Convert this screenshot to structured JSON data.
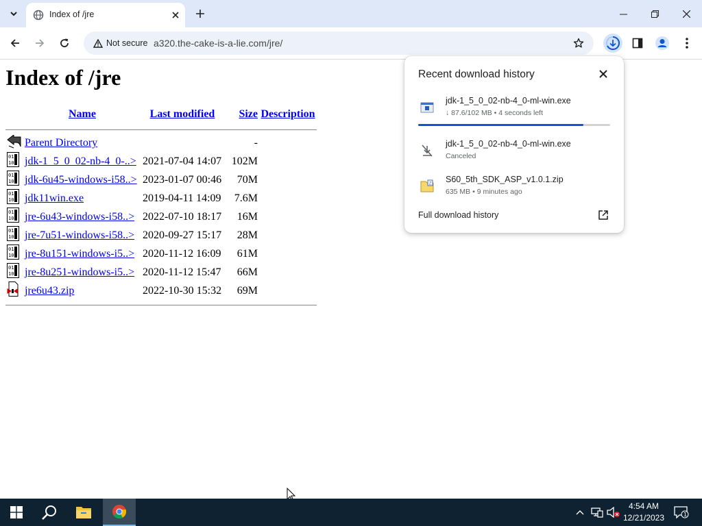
{
  "browser": {
    "tab_title": "Index of /jre",
    "security_label": "Not secure",
    "url": "a320.the-cake-is-a-lie.com/jre/"
  },
  "page": {
    "heading": "Index of /jre",
    "columns": [
      "Name",
      "Last modified",
      "Size",
      "Description"
    ],
    "parent": {
      "name": "Parent Directory",
      "size": "-"
    },
    "files": [
      {
        "name": "jdk-1_5_0_02-nb-4_0-..>",
        "modified": "2021-07-04 14:07",
        "size": "102M",
        "icon": "binary-file-icon"
      },
      {
        "name": "jdk-6u45-windows-i58..>",
        "modified": "2023-01-07 00:46",
        "size": "70M",
        "icon": "binary-file-icon"
      },
      {
        "name": "jdk11win.exe",
        "modified": "2019-04-11 14:09",
        "size": "7.6M",
        "icon": "binary-file-icon"
      },
      {
        "name": "jre-6u43-windows-i58..>",
        "modified": "2022-07-10 18:17",
        "size": "16M",
        "icon": "binary-file-icon"
      },
      {
        "name": "jre-7u51-windows-i58..>",
        "modified": "2020-09-27 15:17",
        "size": "28M",
        "icon": "binary-file-icon"
      },
      {
        "name": "jre-8u151-windows-i5..>",
        "modified": "2020-11-12 16:09",
        "size": "61M",
        "icon": "binary-file-icon"
      },
      {
        "name": "jre-8u251-windows-i5..>",
        "modified": "2020-11-12 15:47",
        "size": "66M",
        "icon": "binary-file-icon"
      },
      {
        "name": "jre6u43.zip",
        "modified": "2022-10-30 15:32",
        "size": "69M",
        "icon": "compressed-file-icon"
      }
    ]
  },
  "downloads": {
    "title": "Recent download history",
    "items": [
      {
        "name": "jdk-1_5_0_02-nb-4_0-ml-win.exe",
        "status": "↓ 87.6/102 MB • 4 seconds left",
        "progress": 0.86,
        "icon": "exe-file-icon"
      },
      {
        "name": "jdk-1_5_0_02-nb-4_0-ml-win.exe",
        "status": "Canceled",
        "icon": "download-off-icon"
      },
      {
        "name": "S60_5th_SDK_ASP_v1.0.1.zip",
        "status": "635 MB • 9 minutes ago",
        "icon": "zip-file-icon"
      }
    ],
    "full_history_label": "Full download history"
  },
  "taskbar": {
    "time": "4:54 AM",
    "date": "12/21/2023",
    "notification_count": "1"
  },
  "colors": {
    "link": "#0000ee",
    "accent": "#0b57d0",
    "tabstrip": "#dee8f8",
    "taskbar": "#0f2231"
  }
}
